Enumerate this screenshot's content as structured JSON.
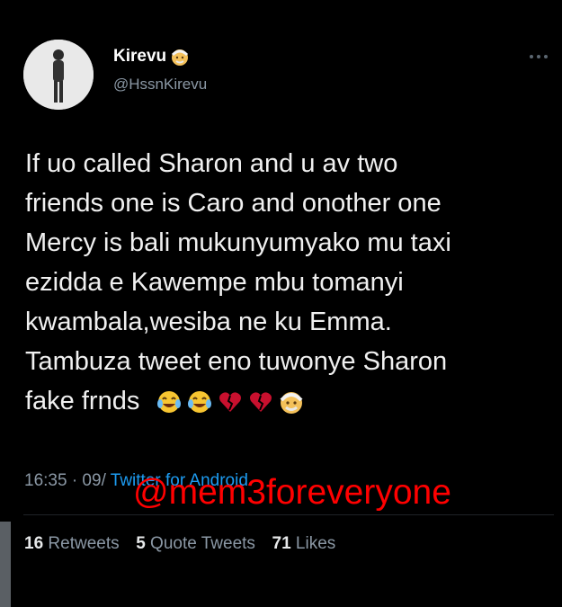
{
  "tweet": {
    "author": {
      "display_name": "Kirevu",
      "handle": "@HssnKirevu",
      "badge_icon": "old-man-emoji-icon"
    },
    "text_lines": [
      "If uo called Sharon and u av two",
      "friends one is Caro and onother one",
      "Mercy is bali mukunyumyako mu taxi",
      "ezidda e Kawempe mbu tomanyi",
      "kwambala,wesiba ne ku Emma.",
      "Tambuza tweet eno tuwonye Sharon",
      "fake frnds"
    ],
    "emojis": [
      "tears-of-joy-emoji-icon",
      "tears-of-joy-emoji-icon",
      "broken-heart-emoji-icon",
      "broken-heart-emoji-icon",
      "old-man-emoji-icon"
    ],
    "timestamp": "16:35 · 09/",
    "source": "Twitter for Android",
    "stats": {
      "retweets_count": "16",
      "retweets_label": "Retweets",
      "quotes_count": "5",
      "quotes_label": "Quote Tweets",
      "likes_count": "71",
      "likes_label": "Likes"
    }
  },
  "watermark": "@mem3foreveryone",
  "colors": {
    "background": "#000000",
    "text": "#e7e9ea",
    "secondary": "#8b98a5",
    "link": "#1d9bf0",
    "watermark": "#ff0000"
  }
}
